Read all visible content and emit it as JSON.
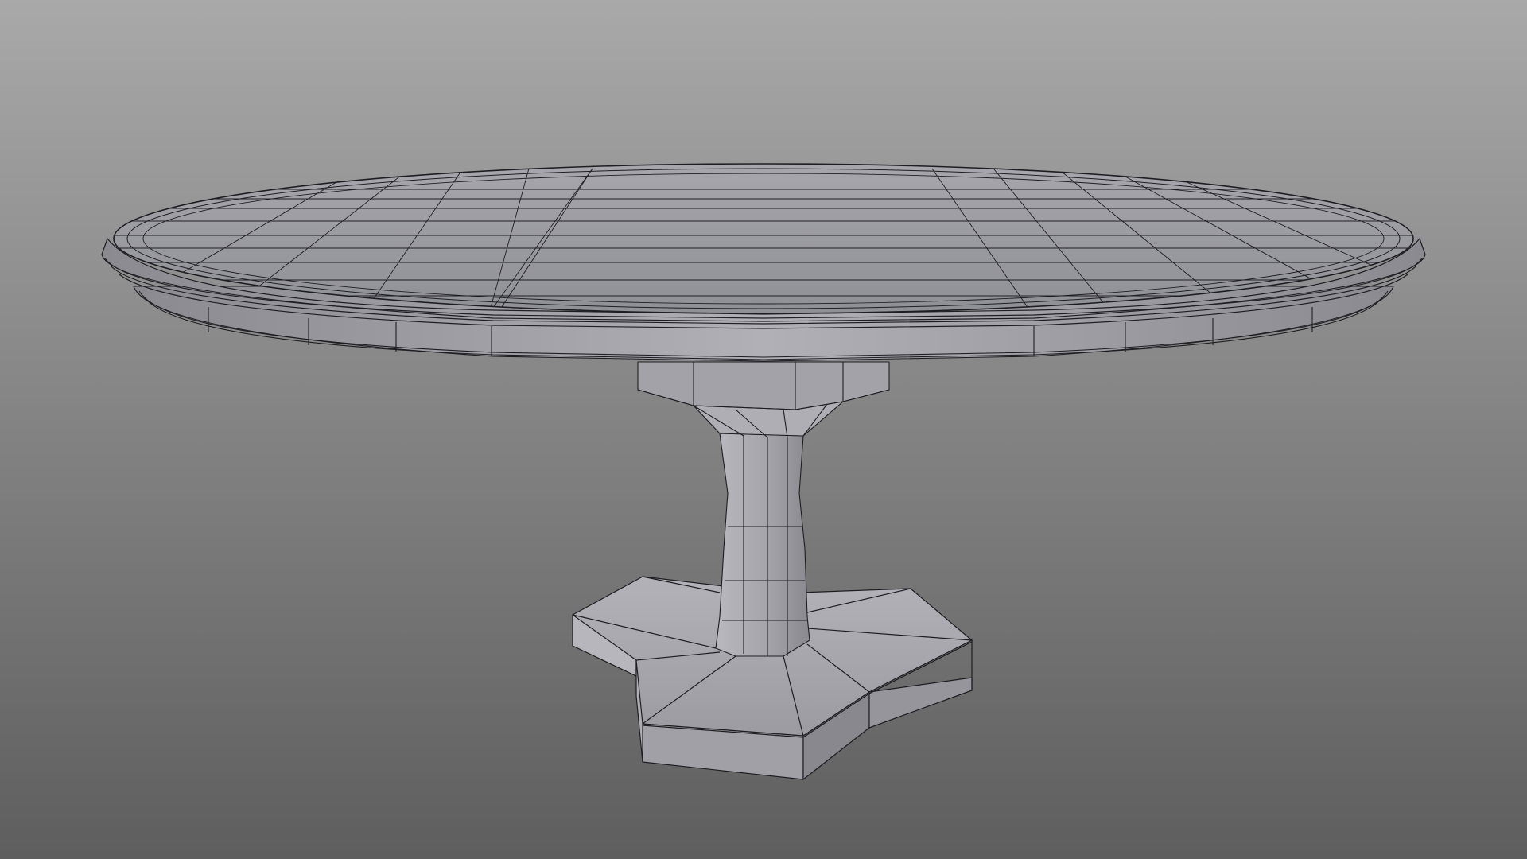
{
  "viewport": {
    "background_top": "#a9a9a9",
    "background_bottom": "#5e5e5e"
  },
  "model": {
    "object": "pedestal-table-wireframe",
    "surface_color": "#9d9da3",
    "surface_light": "#b4b4ba",
    "surface_dark": "#7f7f85",
    "edge_color": "#1e1e22"
  }
}
